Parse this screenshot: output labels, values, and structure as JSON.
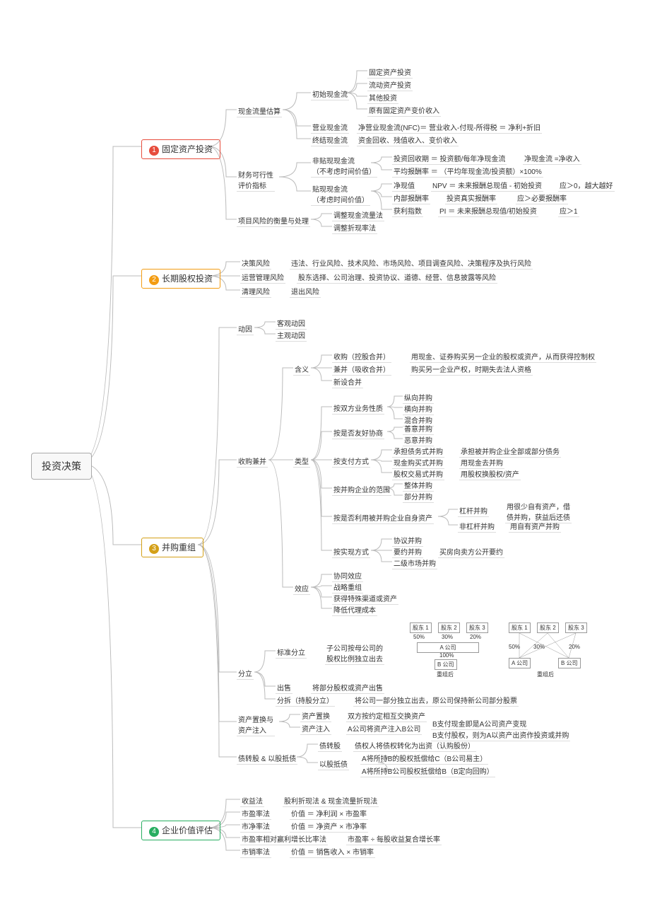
{
  "root": "投资决策",
  "m1": "固定资产投资",
  "m2": "长期股权投资",
  "m3": "并购重组",
  "m4": "企业价值评估",
  "a1": "现金流量估算",
  "a2": "财务可行性\n评价指标",
  "a3": "项目风险的衡量与处理",
  "a1_1": "初始现金流",
  "a1_2": "营业现金流",
  "a1_3": "终结现金流",
  "a1_1a": "固定资产投资",
  "a1_1b": "流动资产投资",
  "a1_1c": "其他投资",
  "a1_1d": "原有固定资产变价收入",
  "a1_2a": "净营业现金流(NFC)＝ 营业收入-付现-所得税 ＝ 净利+折旧",
  "a1_3a": "资金回收、残值收入、变价收入",
  "a2_1": "非贴现现金流\n（不考虑时间价值）",
  "a2_2": "贴现现金流\n（考虑时间价值）",
  "a2_1a": "投资回收期 ＝ 投资额/每年净现金流",
  "a2_1a2": "净现金流 =净收入",
  "a2_1b": "平均报酬率 ＝ （平均年现金流/投资额）×100%",
  "a2_2a": "净现值",
  "a2_2a2": "NPV ＝ 未来报酬总现值 - 初始投资",
  "a2_2a3": "应＞0，越大越好",
  "a2_2b": "内部报酬率",
  "a2_2b2": "投资真实报酬率",
  "a2_2b3": "应＞必要报酬率",
  "a2_2c": "获利指数",
  "a2_2c2": "PI ＝ 未来报酬总现值/初始投资",
  "a2_2c3": "应＞1",
  "a3_1": "调整现金流量法",
  "a3_2": "调整折现率法",
  "b1": "决策风险",
  "b1a": "违法、行业风险、技术风险、市场风险、项目调查风险、决策程序及执行风险",
  "b2": "运营管理风险",
  "b2a": "股东选择、公司治理、投资协议、道德、经营、信息披露等风险",
  "b3": "清理风险",
  "b3a": "退出风险",
  "c1": "动因",
  "c1a": "客观动因",
  "c1b": "主观动因",
  "c2": "收购兼并",
  "c2_1": "含义",
  "c2_1a": "收购（控股合并）",
  "c2_1a2": "用现金、证券购买另一企业的股权或资产，从而获得控制权",
  "c2_1b": "兼并（吸收合并）",
  "c2_1b2": "购买另一企业产权，时期失去法人资格",
  "c2_1c": "新设合并",
  "c2_2": "类型",
  "c2_2a": "按双方业务性质",
  "c2_2a1": "纵向并购",
  "c2_2a2": "横向并购",
  "c2_2a3": "混合并购",
  "c2_2b": "按是否友好协商",
  "c2_2b1": "善意并购",
  "c2_2b2": "恶意并购",
  "c2_2c": "按支付方式",
  "c2_2c1": "承担债务式并购",
  "c2_2c1a": "承担被并购企业全部或部分债务",
  "c2_2c2": "现金购买式并购",
  "c2_2c2a": "用现金去并购",
  "c2_2c3": "股权交易式并购",
  "c2_2c3a": "用股权换股权/资产",
  "c2_2d": "按并购企业的范围",
  "c2_2d1": "整体并购",
  "c2_2d2": "部分并购",
  "c2_2e": "按是否利用被并购企业自身资产",
  "c2_2e1": "杠杆并购",
  "c2_2e1a": "用很少自有资产，借\n债并购，获益后还债",
  "c2_2e2": "非杠杆并购",
  "c2_2e2a": "用自有资产并购",
  "c2_2f": "按实现方式",
  "c2_2f1": "协议并购",
  "c2_2f2": "要约并购",
  "c2_2f2a": "买房向卖方公开要约",
  "c2_2f3": "二级市场并购",
  "c2_3": "效应",
  "c2_3a": "协同效应",
  "c2_3b": "战略重组",
  "c2_3c": "获得特殊渠道或资产",
  "c2_3d": "降低代理成本",
  "c3": "分立",
  "c3_1": "标准分立",
  "c3_1a": "子公司按母公司的\n股权比例独立出去",
  "c3_2": "出售",
  "c3_2a": "将部分股权或资产出售",
  "c3_3": "分拆（持股分立）",
  "c3_3a": "将公司一部分独立出去，原公司保持新公司部分股票",
  "c4": "资产置换与\n资产注入",
  "c4_1": "资产置换",
  "c4_1a": "双方按约定相互交换资产",
  "c4_2": "资产注入",
  "c4_2a": "A公司将资产注入B公司",
  "c4_2b": "B支付现金即是A公司资产变现",
  "c4_2c": "B支付股权，则为A以资产出资作投资或并购",
  "c5": "债转股 & 以股抵债",
  "c5_1": "债转股",
  "c5_1a": "债权人将债权转化为出资（认购股份）",
  "c5_2": "以股抵债",
  "c5_2a": "A将所持B的股权抵偿给C（B公司易主）",
  "c5_2b": "A将所持B公司股权抵偿给B（B定向回购）",
  "d1": "收益法",
  "d1a": "股利折现法 & 现金流量折现法",
  "d2": "市盈率法",
  "d2a": "价值 ＝ 净利润 × 市盈率",
  "d3": "市净率法",
  "d3a": "价值 ＝ 净资产 × 市净率",
  "d4": "市盈率相对赢利增长比率法",
  "d4a": "市盈率 ÷ 每股收益复合增长率",
  "d5": "市销率法",
  "d5a": "价值 ＝ 销售收入 × 市销率",
  "dg_sh1": "股东 1",
  "dg_sh2": "股东 2",
  "dg_sh3": "股东 3",
  "dg_a": "A 公司",
  "dg_b": "B 公司",
  "dg_after": "重组后",
  "dg_50": "50%",
  "dg_30": "30%",
  "dg_20": "20%",
  "dg_100": "100%"
}
